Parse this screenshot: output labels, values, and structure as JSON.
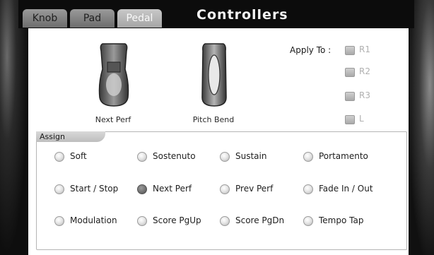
{
  "window": {
    "title": "Controllers"
  },
  "tabs": [
    {
      "label": "Knob",
      "active": false
    },
    {
      "label": "Pad",
      "active": false
    },
    {
      "label": "Pedal",
      "active": true
    }
  ],
  "pedals": [
    {
      "label": "Next Perf",
      "icon": "sustain-pedal-icon"
    },
    {
      "label": "Pitch Bend",
      "icon": "expression-pedal-icon"
    }
  ],
  "apply": {
    "label": "Apply To :",
    "options": [
      {
        "label": "R1",
        "checked": false
      },
      {
        "label": "R2",
        "checked": false
      },
      {
        "label": "R3",
        "checked": false
      },
      {
        "label": "L",
        "checked": false
      }
    ]
  },
  "assign": {
    "label": "Assign",
    "selected": "Next Perf",
    "options": [
      [
        "Soft",
        "Sostenuto",
        "Sustain",
        "Portamento"
      ],
      [
        "Start / Stop",
        "Next Perf",
        "Prev Perf",
        "Fade In / Out"
      ],
      [
        "Modulation",
        "Score PgUp",
        "Score PgDn",
        "Tempo Tap"
      ]
    ]
  }
}
